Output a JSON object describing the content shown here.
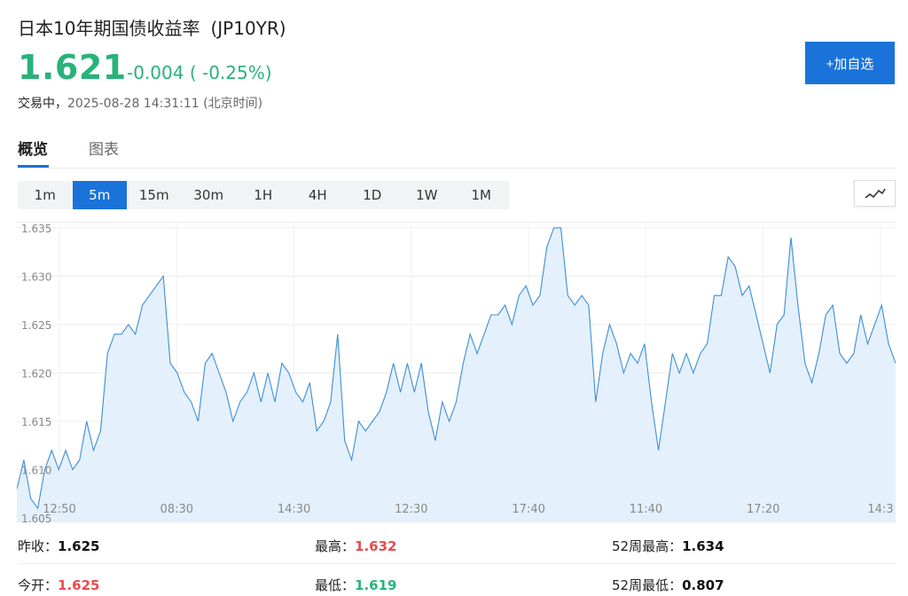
{
  "header": {
    "title": "日本10年期国债收益率",
    "code": "(JP10YR)",
    "price": "1.621",
    "change": "-0.004 ( -0.25%)",
    "status_label": "交易中，",
    "timestamp": "2025-08-28 14:31:11",
    "timezone": "(北京时间)",
    "add_button": "+加自选"
  },
  "tabs": [
    {
      "label": "概览",
      "active": true
    },
    {
      "label": "图表",
      "active": false
    }
  ],
  "periods": [
    {
      "label": "1m",
      "active": false
    },
    {
      "label": "5m",
      "active": true
    },
    {
      "label": "15m",
      "active": false
    },
    {
      "label": "30m",
      "active": false
    },
    {
      "label": "1H",
      "active": false
    },
    {
      "label": "4H",
      "active": false
    },
    {
      "label": "1D",
      "active": false
    },
    {
      "label": "1W",
      "active": false
    },
    {
      "label": "1M",
      "active": false
    }
  ],
  "chart_type_icon": "line-chart-icon",
  "colors": {
    "up": "#e84c4c",
    "down": "#2ab27b",
    "accent": "#1a73d9",
    "line": "#3c8ed8",
    "fill": "#e4f0fb"
  },
  "chart_data": {
    "type": "area",
    "y_ticks": [
      "1.605",
      "1.610",
      "1.615",
      "1.620",
      "1.625",
      "1.630",
      "1.635"
    ],
    "ylim": [
      1.605,
      1.636
    ],
    "x_ticks": [
      "12:50",
      "08:30",
      "14:30",
      "12:30",
      "17:40",
      "11:40",
      "17:20",
      "14:3"
    ],
    "grid": true,
    "values": [
      1.608,
      1.611,
      1.607,
      1.606,
      1.61,
      1.612,
      1.61,
      1.612,
      1.61,
      1.611,
      1.615,
      1.612,
      1.614,
      1.622,
      1.624,
      1.624,
      1.625,
      1.624,
      1.627,
      1.628,
      1.629,
      1.63,
      1.621,
      1.62,
      1.618,
      1.617,
      1.615,
      1.621,
      1.622,
      1.62,
      1.618,
      1.615,
      1.617,
      1.618,
      1.62,
      1.617,
      1.62,
      1.617,
      1.621,
      1.62,
      1.618,
      1.617,
      1.619,
      1.614,
      1.615,
      1.617,
      1.624,
      1.613,
      1.611,
      1.615,
      1.614,
      1.615,
      1.616,
      1.618,
      1.621,
      1.618,
      1.621,
      1.618,
      1.621,
      1.616,
      1.613,
      1.617,
      1.615,
      1.617,
      1.621,
      1.624,
      1.622,
      1.624,
      1.626,
      1.626,
      1.627,
      1.625,
      1.628,
      1.629,
      1.627,
      1.628,
      1.633,
      1.635,
      1.635,
      1.628,
      1.627,
      1.628,
      1.627,
      1.617,
      1.622,
      1.625,
      1.623,
      1.62,
      1.622,
      1.621,
      1.623,
      1.617,
      1.612,
      1.617,
      1.622,
      1.62,
      1.622,
      1.62,
      1.622,
      1.623,
      1.628,
      1.628,
      1.632,
      1.631,
      1.628,
      1.629,
      1.626,
      1.623,
      1.62,
      1.625,
      1.626,
      1.634,
      1.627,
      1.621,
      1.619,
      1.622,
      1.626,
      1.627,
      1.622,
      1.621,
      1.622,
      1.626,
      1.623,
      1.625,
      1.627,
      1.623,
      1.621
    ]
  },
  "stats": {
    "prev_close_label": "昨收：",
    "prev_close": "1.625",
    "high_label": "最高：",
    "high": "1.632",
    "w52_high_label": "52周最高：",
    "w52_high": "1.634",
    "open_label": "今开：",
    "open": "1.625",
    "low_label": "最低：",
    "low": "1.619",
    "w52_low_label": "52周最低：",
    "w52_low": "0.807"
  }
}
